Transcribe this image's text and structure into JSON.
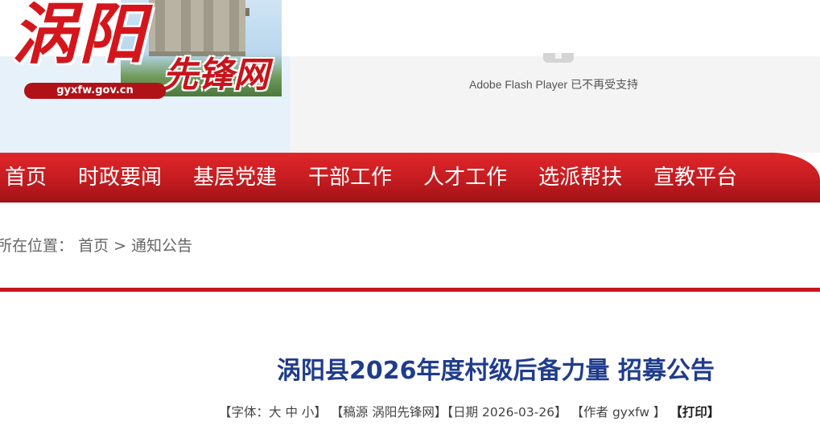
{
  "header": {
    "logo_text": "涡阳",
    "logo_subtitle": "先锋网",
    "logo_url": "gyxfw.gov.cn",
    "flash_notice": "Adobe Flash Player 已不再受支持"
  },
  "nav": {
    "items": [
      "首页",
      "时政要闻",
      "基层党建",
      "干部工作",
      "人才工作",
      "选派帮扶",
      "宣教平台"
    ]
  },
  "breadcrumb": {
    "prefix": "所在位置：",
    "home": "首页",
    "separator": ">",
    "current": "通知公告"
  },
  "article": {
    "title": "涡阳县2026年度村级后备力量 招募公告",
    "meta": {
      "font_label": "【字体：",
      "font_large": "大",
      "font_medium": "中",
      "font_small": "小",
      "font_close": "】",
      "source": "【稿源 涡阳先锋网】",
      "date": "【日期 2026-03-26】",
      "author": "【作者 gyxfw 】",
      "print": "【打印】"
    }
  },
  "colors": {
    "brand_red": "#c8161d",
    "title_blue": "#1f3c8c"
  }
}
